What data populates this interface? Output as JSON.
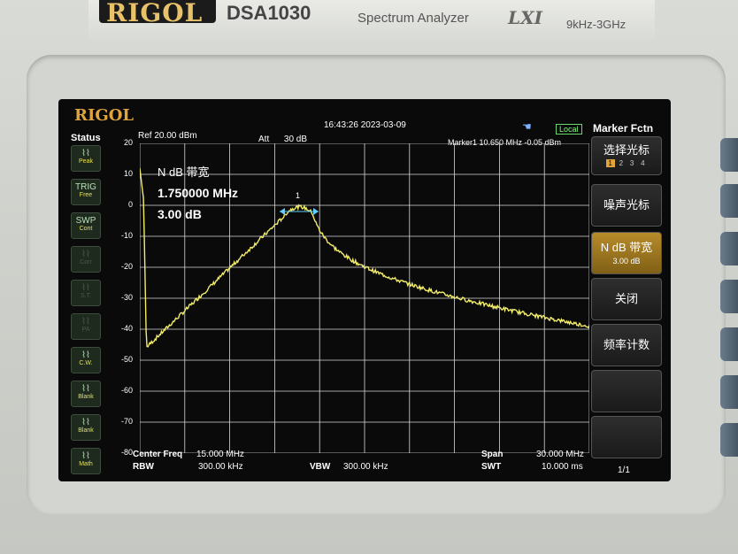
{
  "device": {
    "brand": "RIGOL",
    "model": "DSA1030",
    "type": "Spectrum Analyzer",
    "lxi": "LXI",
    "range": "9kHz-3GHz"
  },
  "screen": {
    "logo": "RIGOL",
    "time": "16:43:26 2023-03-09",
    "local": "Local",
    "ref": "Ref  20.00 dBm",
    "att_label": "Att",
    "att_value": "30 dB",
    "marker_readout": "Marker1  10.650 MHz  -0.05 dBm",
    "measurement": {
      "title": "N dB 带宽",
      "bandwidth": "1.750000 MHz",
      "ndb": "3.00 dB"
    },
    "marker_num": "1",
    "status": {
      "label": "Status",
      "items": [
        {
          "icon": "peak-icon",
          "text": "Peak",
          "active": true
        },
        {
          "icon": "trig-icon",
          "top": "TRIG",
          "text": "Free",
          "active": true
        },
        {
          "icon": "swp-icon",
          "top": "SWP",
          "text": "Cont",
          "active": true
        },
        {
          "icon": "corr-icon",
          "text": "Corr",
          "active": false
        },
        {
          "icon": "st-icon",
          "text": "S.T.",
          "active": false
        },
        {
          "icon": "pa-icon",
          "text": "PA",
          "active": false
        },
        {
          "icon": "cw-icon",
          "text": "C.W.",
          "active": true
        },
        {
          "icon": "blank-icon",
          "text": "Blank",
          "active": true
        },
        {
          "icon": "blank-icon",
          "text": "Blank",
          "active": true
        },
        {
          "icon": "math-icon",
          "text": "Math",
          "active": true
        }
      ]
    },
    "y_ticks": [
      "20",
      "10",
      "0",
      "-10",
      "-20",
      "-30",
      "-40",
      "-50",
      "-60",
      "-70",
      "-80"
    ],
    "bottom": {
      "center_label": "Center Freq",
      "center_value": "15.000 MHz",
      "span_label": "Span",
      "span_value": "30.000 MHz",
      "rbw_label": "RBW",
      "rbw_value": "300.00 kHz",
      "vbw_label": "VBW",
      "vbw_value": "300.00 kHz",
      "swt_label": "SWT",
      "swt_value": "10.000 ms"
    },
    "menu": {
      "title": "Marker Fctn",
      "items": [
        {
          "label": "选择光标",
          "tabs": [
            "1",
            "2",
            "3",
            "4"
          ],
          "selected_tab": "1"
        },
        {
          "label": "噪声光标"
        },
        {
          "label": "N dB 带宽",
          "sub": "3.00 dB",
          "selected": true
        },
        {
          "label": "关闭"
        },
        {
          "label": "频率计数"
        },
        {
          "label": ""
        },
        {
          "label": ""
        }
      ],
      "page": "1/1"
    }
  },
  "colors": {
    "trace": "#f2ec6a",
    "grid": "#d8d8d8",
    "accent": "#e0a43a"
  }
}
